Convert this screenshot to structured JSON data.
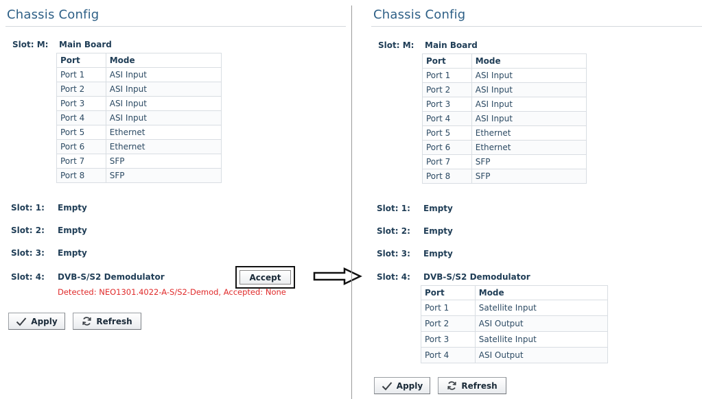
{
  "left": {
    "title": "Chassis Config",
    "slot_m": {
      "label": "Slot: M:",
      "value": "Main Board"
    },
    "table": {
      "headers": [
        "Port",
        "Mode"
      ],
      "rows": [
        [
          "Port 1",
          "ASI Input"
        ],
        [
          "Port 2",
          "ASI Input"
        ],
        [
          "Port 3",
          "ASI Input"
        ],
        [
          "Port 4",
          "ASI Input"
        ],
        [
          "Port 5",
          "Ethernet"
        ],
        [
          "Port 6",
          "Ethernet"
        ],
        [
          "Port 7",
          "SFP"
        ],
        [
          "Port 8",
          "SFP"
        ]
      ]
    },
    "slot_1": {
      "label": "Slot: 1:",
      "value": "Empty"
    },
    "slot_2": {
      "label": "Slot: 2:",
      "value": "Empty"
    },
    "slot_3": {
      "label": "Slot: 3:",
      "value": "Empty"
    },
    "slot_4": {
      "label": "Slot: 4:",
      "value": "DVB-S/S2 Demodulator"
    },
    "accept_label": "Accept",
    "detected_text": "Detected: NEO1301.4022-A-S/S2-Demod, Accepted: None",
    "apply_label": "Apply",
    "refresh_label": "Refresh"
  },
  "right": {
    "title": "Chassis Config",
    "slot_m": {
      "label": "Slot: M:",
      "value": "Main Board"
    },
    "table": {
      "headers": [
        "Port",
        "Mode"
      ],
      "rows": [
        [
          "Port 1",
          "ASI Input"
        ],
        [
          "Port 2",
          "ASI Input"
        ],
        [
          "Port 3",
          "ASI Input"
        ],
        [
          "Port 4",
          "ASI Input"
        ],
        [
          "Port 5",
          "Ethernet"
        ],
        [
          "Port 6",
          "Ethernet"
        ],
        [
          "Port 7",
          "SFP"
        ],
        [
          "Port 8",
          "SFP"
        ]
      ]
    },
    "slot_1": {
      "label": "Slot: 1:",
      "value": "Empty"
    },
    "slot_2": {
      "label": "Slot: 2:",
      "value": "Empty"
    },
    "slot_3": {
      "label": "Slot: 3:",
      "value": "Empty"
    },
    "slot_4": {
      "label": "Slot: 4:",
      "value": "DVB-S/S2 Demodulator"
    },
    "demod_table": {
      "headers": [
        "Port",
        "Mode"
      ],
      "rows": [
        [
          "Port 1",
          "Satellite Input"
        ],
        [
          "Port 2",
          "ASI Output"
        ],
        [
          "Port 3",
          "Satellite Input"
        ],
        [
          "Port 4",
          "ASI Output"
        ]
      ]
    },
    "apply_label": "Apply",
    "refresh_label": "Refresh"
  },
  "colors": {
    "title": "#2d5f86",
    "text": "#1f3d56",
    "detected": "#e02a2a"
  },
  "icons": [
    "checkmark-icon",
    "refresh-icon",
    "right-arrow-icon"
  ]
}
